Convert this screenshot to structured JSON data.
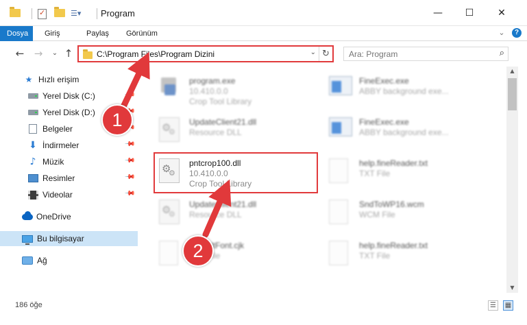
{
  "window": {
    "title": "Program",
    "minimize_glyph": "—",
    "maximize_glyph": "☐",
    "close_glyph": "✕"
  },
  "ribbon": {
    "tabs": [
      {
        "label": "Dosya",
        "active": true
      },
      {
        "label": "Giriş",
        "active": false
      },
      {
        "label": "Paylaş",
        "active": false
      },
      {
        "label": "Görünüm",
        "active": false
      }
    ],
    "expand_glyph": "⌄",
    "help_label": "?"
  },
  "nav": {
    "back_glyph": "←",
    "forward_glyph": "→",
    "recent_glyph": "⌄",
    "up_glyph": "↑",
    "address_path": "C:\\Program Files\\Program Dizini",
    "dropdown_glyph": "⌄",
    "refresh_glyph": "↻",
    "search_placeholder": "Ara: Program",
    "search_glyph": "⌕"
  },
  "sidebar": {
    "items": [
      {
        "label": "Hızlı erişim",
        "icon": "star-icon",
        "pinned": false
      },
      {
        "label": "Yerel Disk (C:)",
        "icon": "drive-icon",
        "pinned": true
      },
      {
        "label": "Yerel Disk (D:)",
        "icon": "drive-icon",
        "pinned": true
      },
      {
        "label": "Belgeler",
        "icon": "documents-icon",
        "pinned": true
      },
      {
        "label": "İndirmeler",
        "icon": "download-icon",
        "pinned": true
      },
      {
        "label": "Müzik",
        "icon": "music-icon",
        "pinned": true
      },
      {
        "label": "Resimler",
        "icon": "pictures-icon",
        "pinned": true
      },
      {
        "label": "Videolar",
        "icon": "videos-icon",
        "pinned": true
      },
      {
        "label": "OneDrive",
        "icon": "onedrive-icon",
        "pinned": false
      },
      {
        "label": "Bu bilgisayar",
        "icon": "this-pc-icon",
        "pinned": false,
        "selected": true
      },
      {
        "label": "Ağ",
        "icon": "network-icon",
        "pinned": false
      }
    ],
    "pin_glyph": "📌"
  },
  "files": [
    {
      "name": "program.exe",
      "sub1": "10.410.0.0",
      "sub2": "Crop Tool Library",
      "icon": "app-file-icon",
      "blurred": true
    },
    {
      "name": "FineExec.exe",
      "sub1": "ABBY background exe...",
      "sub2": "",
      "icon": "exe-file-icon",
      "blurred": true
    },
    {
      "name": "UpdateClient21.dll",
      "sub1": "Resource DLL",
      "sub2": "",
      "icon": "dll-file-icon",
      "blurred": true
    },
    {
      "name": "FineExec.exe",
      "sub1": "ABBY background exe...",
      "sub2": "",
      "icon": "exe-file-icon",
      "blurred": true
    },
    {
      "name": "pntcrop100.dll",
      "sub1": "10.410.0.0",
      "sub2": "Crop Tool Library",
      "icon": "dll-file-icon",
      "blurred": false
    },
    {
      "name": "help.fineReader.txt",
      "sub1": "TXT File",
      "sub2": "",
      "icon": "text-file-icon",
      "blurred": true
    },
    {
      "name": "UpdateClient21.dll",
      "sub1": "Resource DLL",
      "sub2": "",
      "icon": "dll-file-icon",
      "blurred": true
    },
    {
      "name": "SndToWP16.wcm",
      "sub1": "WCM File",
      "sub2": "",
      "icon": "text-file-icon",
      "blurred": true
    },
    {
      "name": "DefaultFont.cjk",
      "sub1": "CJK File",
      "sub2": "",
      "icon": "text-file-icon",
      "blurred": true
    },
    {
      "name": "help.fineReader.txt",
      "sub1": "TXT File",
      "sub2": "",
      "icon": "text-file-icon",
      "blurred": true
    }
  ],
  "scrollbar": {
    "up_glyph": "▲",
    "down_glyph": "▼"
  },
  "status": {
    "item_count": "186 öğe",
    "details_view_glyph": "☰",
    "tiles_view_glyph": "▦"
  },
  "annotations": {
    "step1": "1",
    "step2": "2",
    "color": "#e1393b"
  }
}
